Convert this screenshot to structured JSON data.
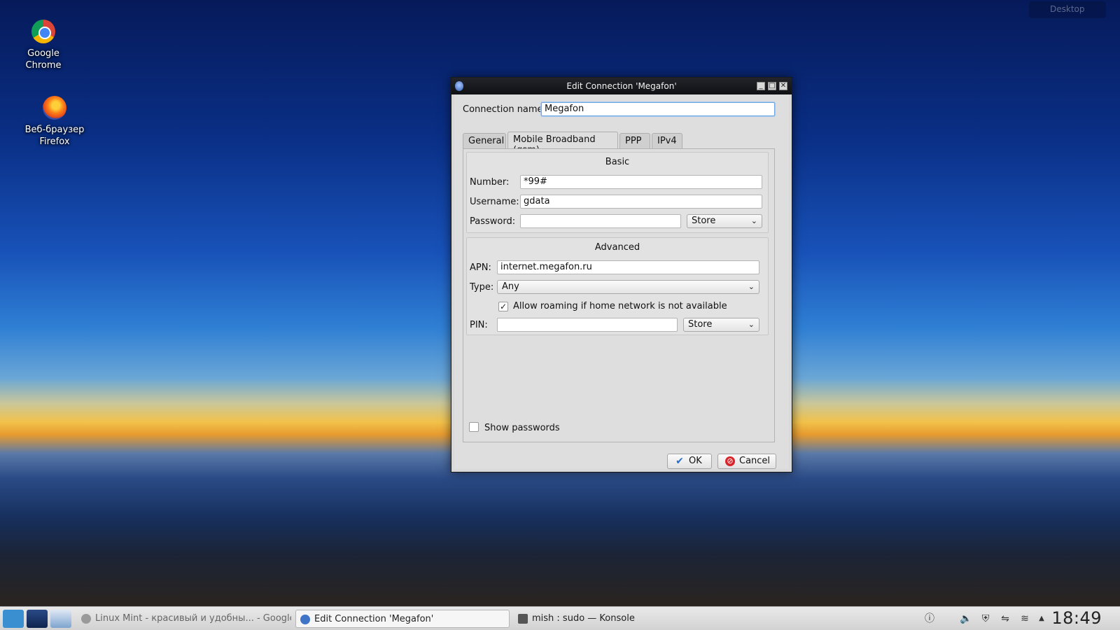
{
  "desktop": {
    "icons": [
      {
        "label": "Google Chrome"
      },
      {
        "label": "Веб-браузер Firefox"
      }
    ],
    "widget_label": "Desktop"
  },
  "window": {
    "title": "Edit Connection 'Megafon'",
    "connection_name_label": "Connection name:",
    "connection_name_value": "Megafon",
    "tabs": [
      {
        "label": "General"
      },
      {
        "label": "Mobile Broadband (gsm)"
      },
      {
        "label": "PPP"
      },
      {
        "label": "IPv4"
      }
    ],
    "basic": {
      "title": "Basic",
      "number_label": "Number:",
      "number_value": "*99#",
      "username_label": "Username:",
      "username_value": "gdata",
      "password_label": "Password:",
      "password_value": "",
      "password_store": "Store"
    },
    "advanced": {
      "title": "Advanced",
      "apn_label": "APN:",
      "apn_value": "internet.megafon.ru",
      "type_label": "Type:",
      "type_value": "Any",
      "roaming_label": "Allow roaming if home network is not available",
      "roaming_checked": true,
      "pin_label": "PIN:",
      "pin_value": "",
      "pin_store": "Store"
    },
    "show_passwords_label": "Show passwords",
    "ok_label": "OK",
    "cancel_label": "Cancel"
  },
  "taskbar": {
    "tasks": [
      {
        "label": "Linux Mint - красивый и удобны... - Google Ch"
      },
      {
        "label": "Edit Connection 'Megafon'"
      },
      {
        "label": "mish : sudo — Konsole"
      }
    ],
    "clock": "18:49"
  }
}
